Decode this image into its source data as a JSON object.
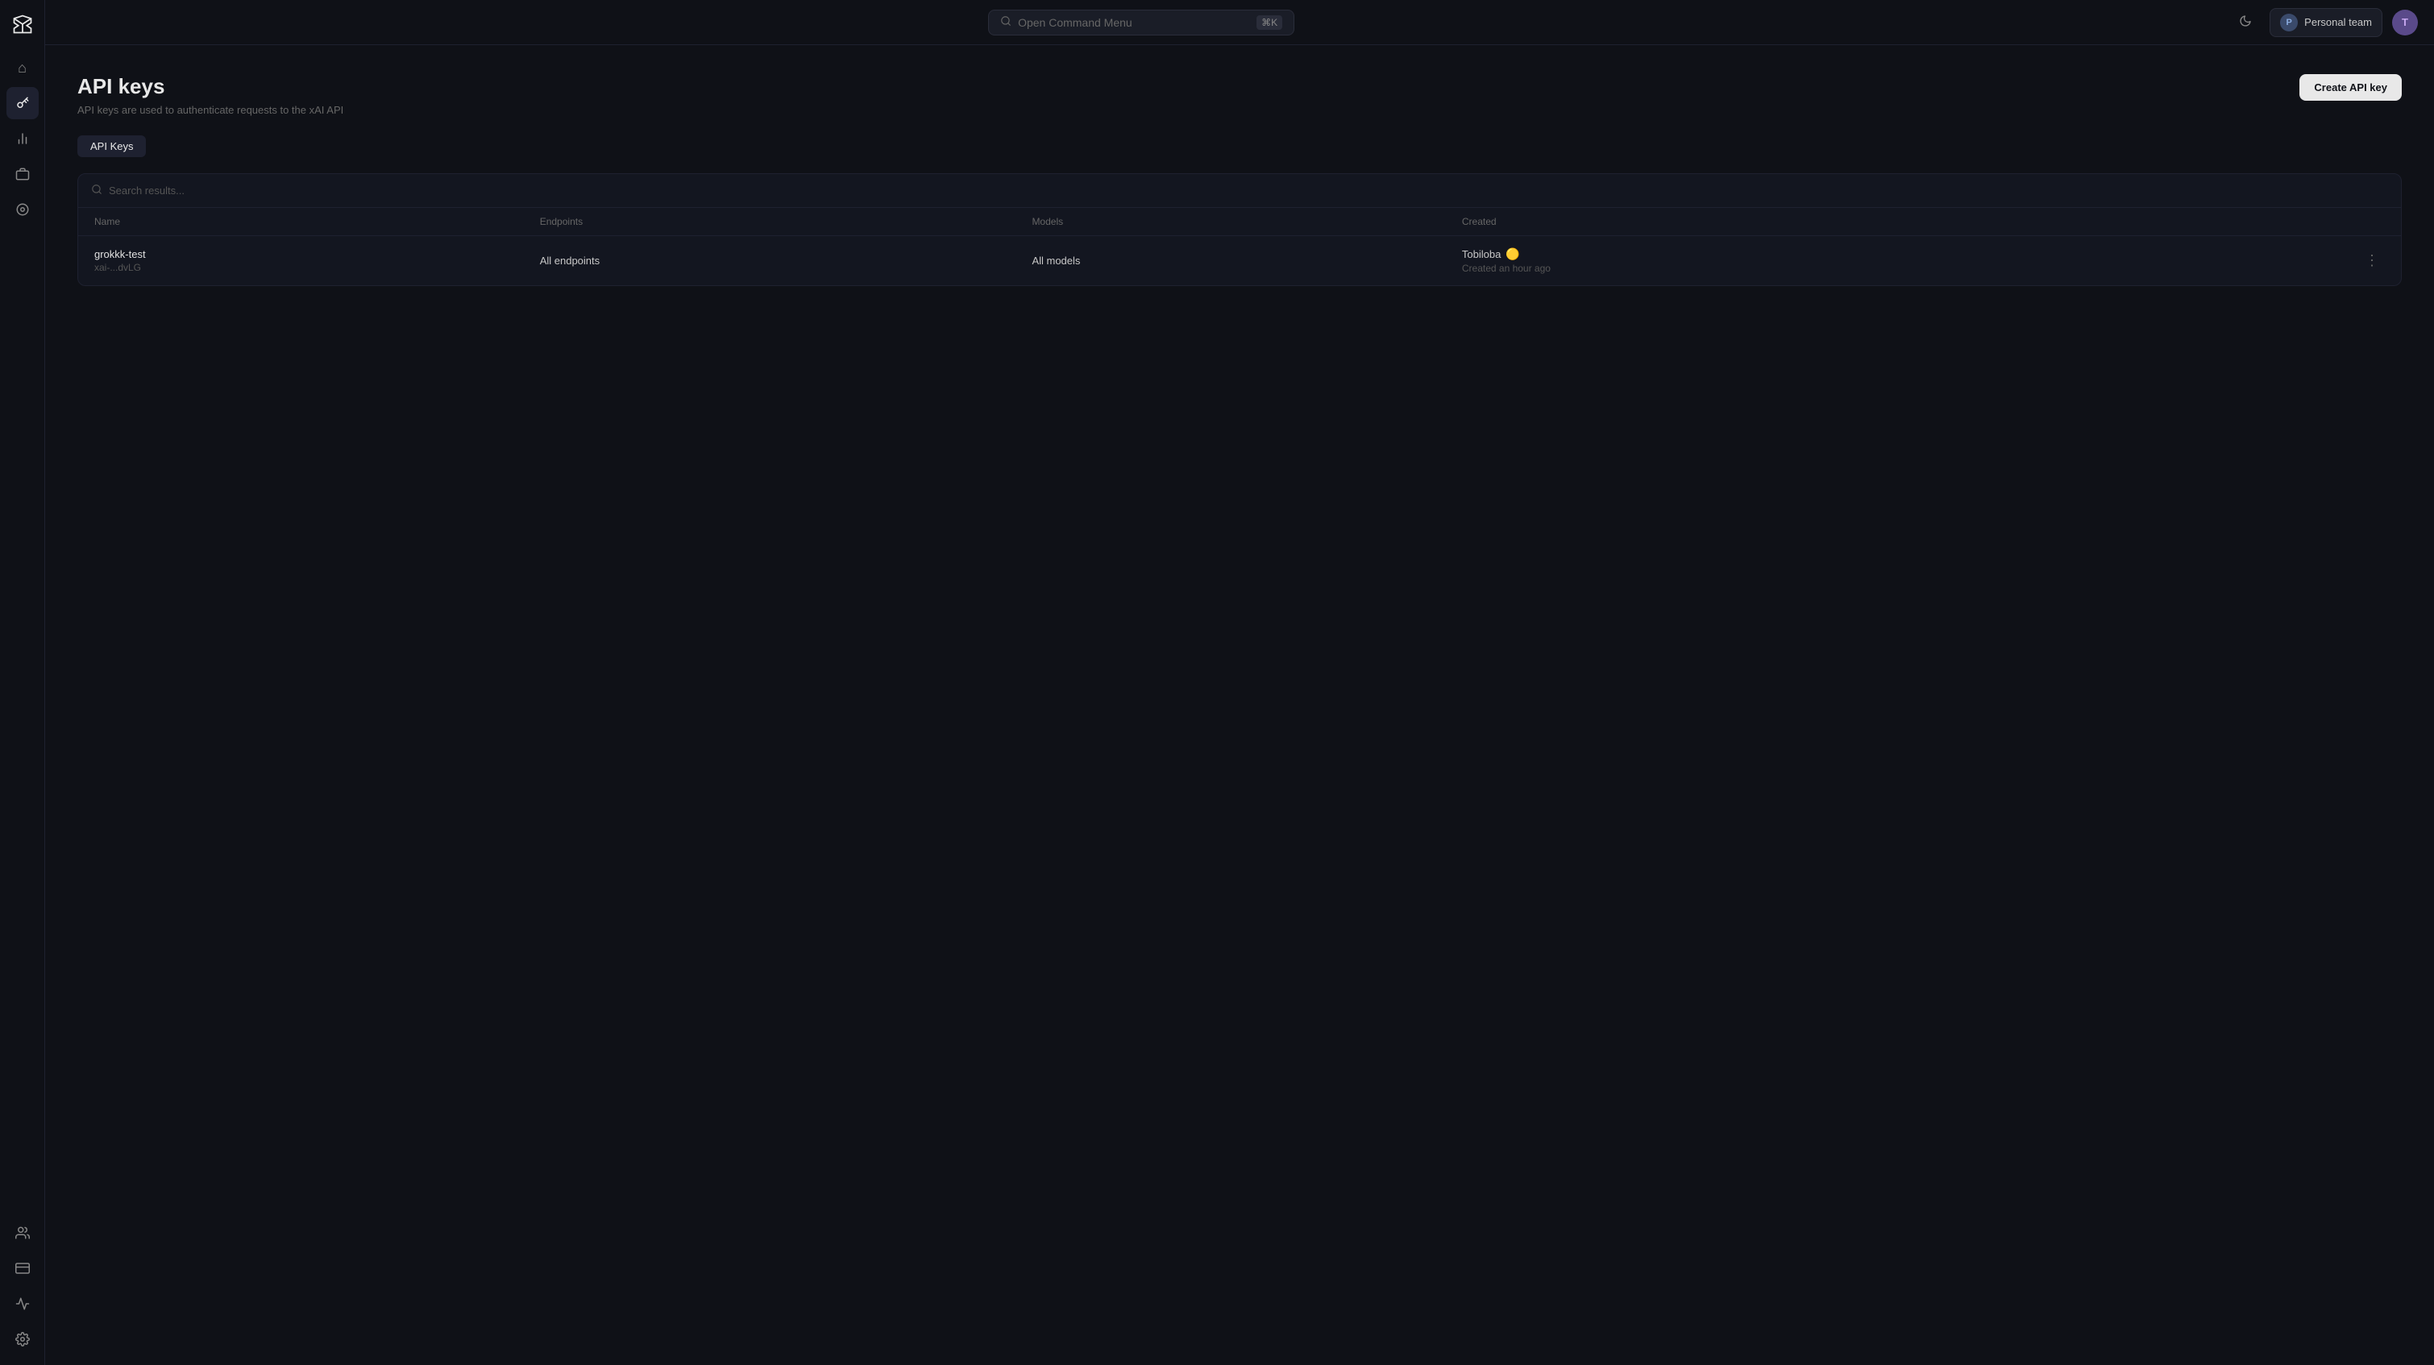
{
  "app": {
    "logo_label": "xAI"
  },
  "topbar": {
    "search_placeholder": "Open Command Menu",
    "search_shortcut": "⌘K",
    "team_initial": "P",
    "team_name": "Personal team",
    "user_initial": "T"
  },
  "sidebar": {
    "items": [
      {
        "id": "home",
        "icon": "⌂",
        "label": "Home"
      },
      {
        "id": "api-keys",
        "icon": "🔑",
        "label": "API Keys",
        "active": true
      },
      {
        "id": "analytics",
        "icon": "📊",
        "label": "Analytics"
      },
      {
        "id": "products",
        "icon": "📦",
        "label": "Products"
      },
      {
        "id": "docs",
        "icon": "◎",
        "label": "Docs"
      }
    ],
    "bottom_items": [
      {
        "id": "team",
        "icon": "👥",
        "label": "Team"
      },
      {
        "id": "billing",
        "icon": "💳",
        "label": "Billing"
      },
      {
        "id": "metrics",
        "icon": "📈",
        "label": "Metrics"
      },
      {
        "id": "settings",
        "icon": "⚙",
        "label": "Settings"
      }
    ]
  },
  "page": {
    "title": "API keys",
    "subtitle": "API keys are used to authenticate requests to the xAI API",
    "create_button_label": "Create API key"
  },
  "tabs": [
    {
      "id": "api-keys",
      "label": "API Keys",
      "active": true
    }
  ],
  "table": {
    "search_placeholder": "Search results...",
    "columns": [
      {
        "id": "name",
        "label": "Name"
      },
      {
        "id": "endpoints",
        "label": "Endpoints"
      },
      {
        "id": "models",
        "label": "Models"
      },
      {
        "id": "created",
        "label": "Created"
      }
    ],
    "rows": [
      {
        "name": "grokkk-test",
        "key_id": "xai-...dvLG",
        "endpoints": "All endpoints",
        "models": "All models",
        "creator": "Tobiloba",
        "creator_verified": true,
        "created_time": "Created an hour ago"
      }
    ]
  }
}
